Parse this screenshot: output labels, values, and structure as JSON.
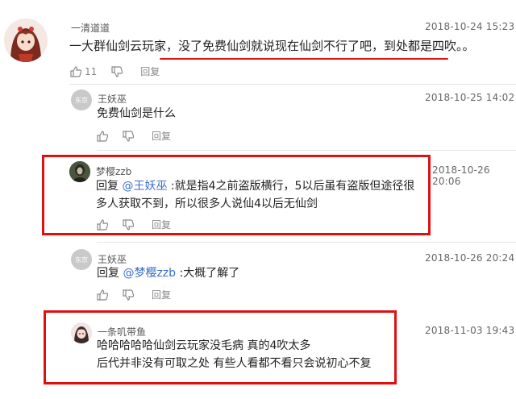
{
  "main_comment": {
    "username": "一清道道",
    "timestamp": "2018-10-24 15:23",
    "text": "一大群仙剑云玩家，没了免费仙剑就说现在仙剑不行了吧，到处都是四吹。。",
    "like_count": "11",
    "reply_label": "回复"
  },
  "replies": [
    {
      "username": "王妖巫",
      "avatar_text": "东京",
      "timestamp": "2018-10-25 14:02",
      "line1": "免费仙剑是什么",
      "reply_label": "回复"
    },
    {
      "username": "梦樱zzb",
      "timestamp": "2018-10-26 20:06",
      "prefix": "回复",
      "mention": "@王妖巫",
      "line1": ":就是指4之前盗版横行，5以后虽有盗版但途径很",
      "line2": "多人获取不到，所以很多人说仙4以后无仙剑",
      "reply_label": "回复"
    },
    {
      "username": "王妖巫",
      "avatar_text": "东京",
      "timestamp": "2018-10-26 20:24",
      "prefix": "回复",
      "mention": "@梦樱zzb",
      "line1": ":大概了解了",
      "reply_label": "回复"
    },
    {
      "username": "一条叽带鱼",
      "timestamp": "2018-11-03 19:43",
      "line1": "哈哈哈哈哈仙剑云玩家没毛病 真的4吹太多",
      "line2": "后代并非没有可取之处 有些人看都不看只会说初心不复"
    }
  ],
  "colors": {
    "highlight_red": "#e01010",
    "mention_blue": "#3a6ec8",
    "meta_gray": "#888888"
  },
  "icons": [
    "thumbs-up-icon",
    "thumbs-down-icon"
  ]
}
